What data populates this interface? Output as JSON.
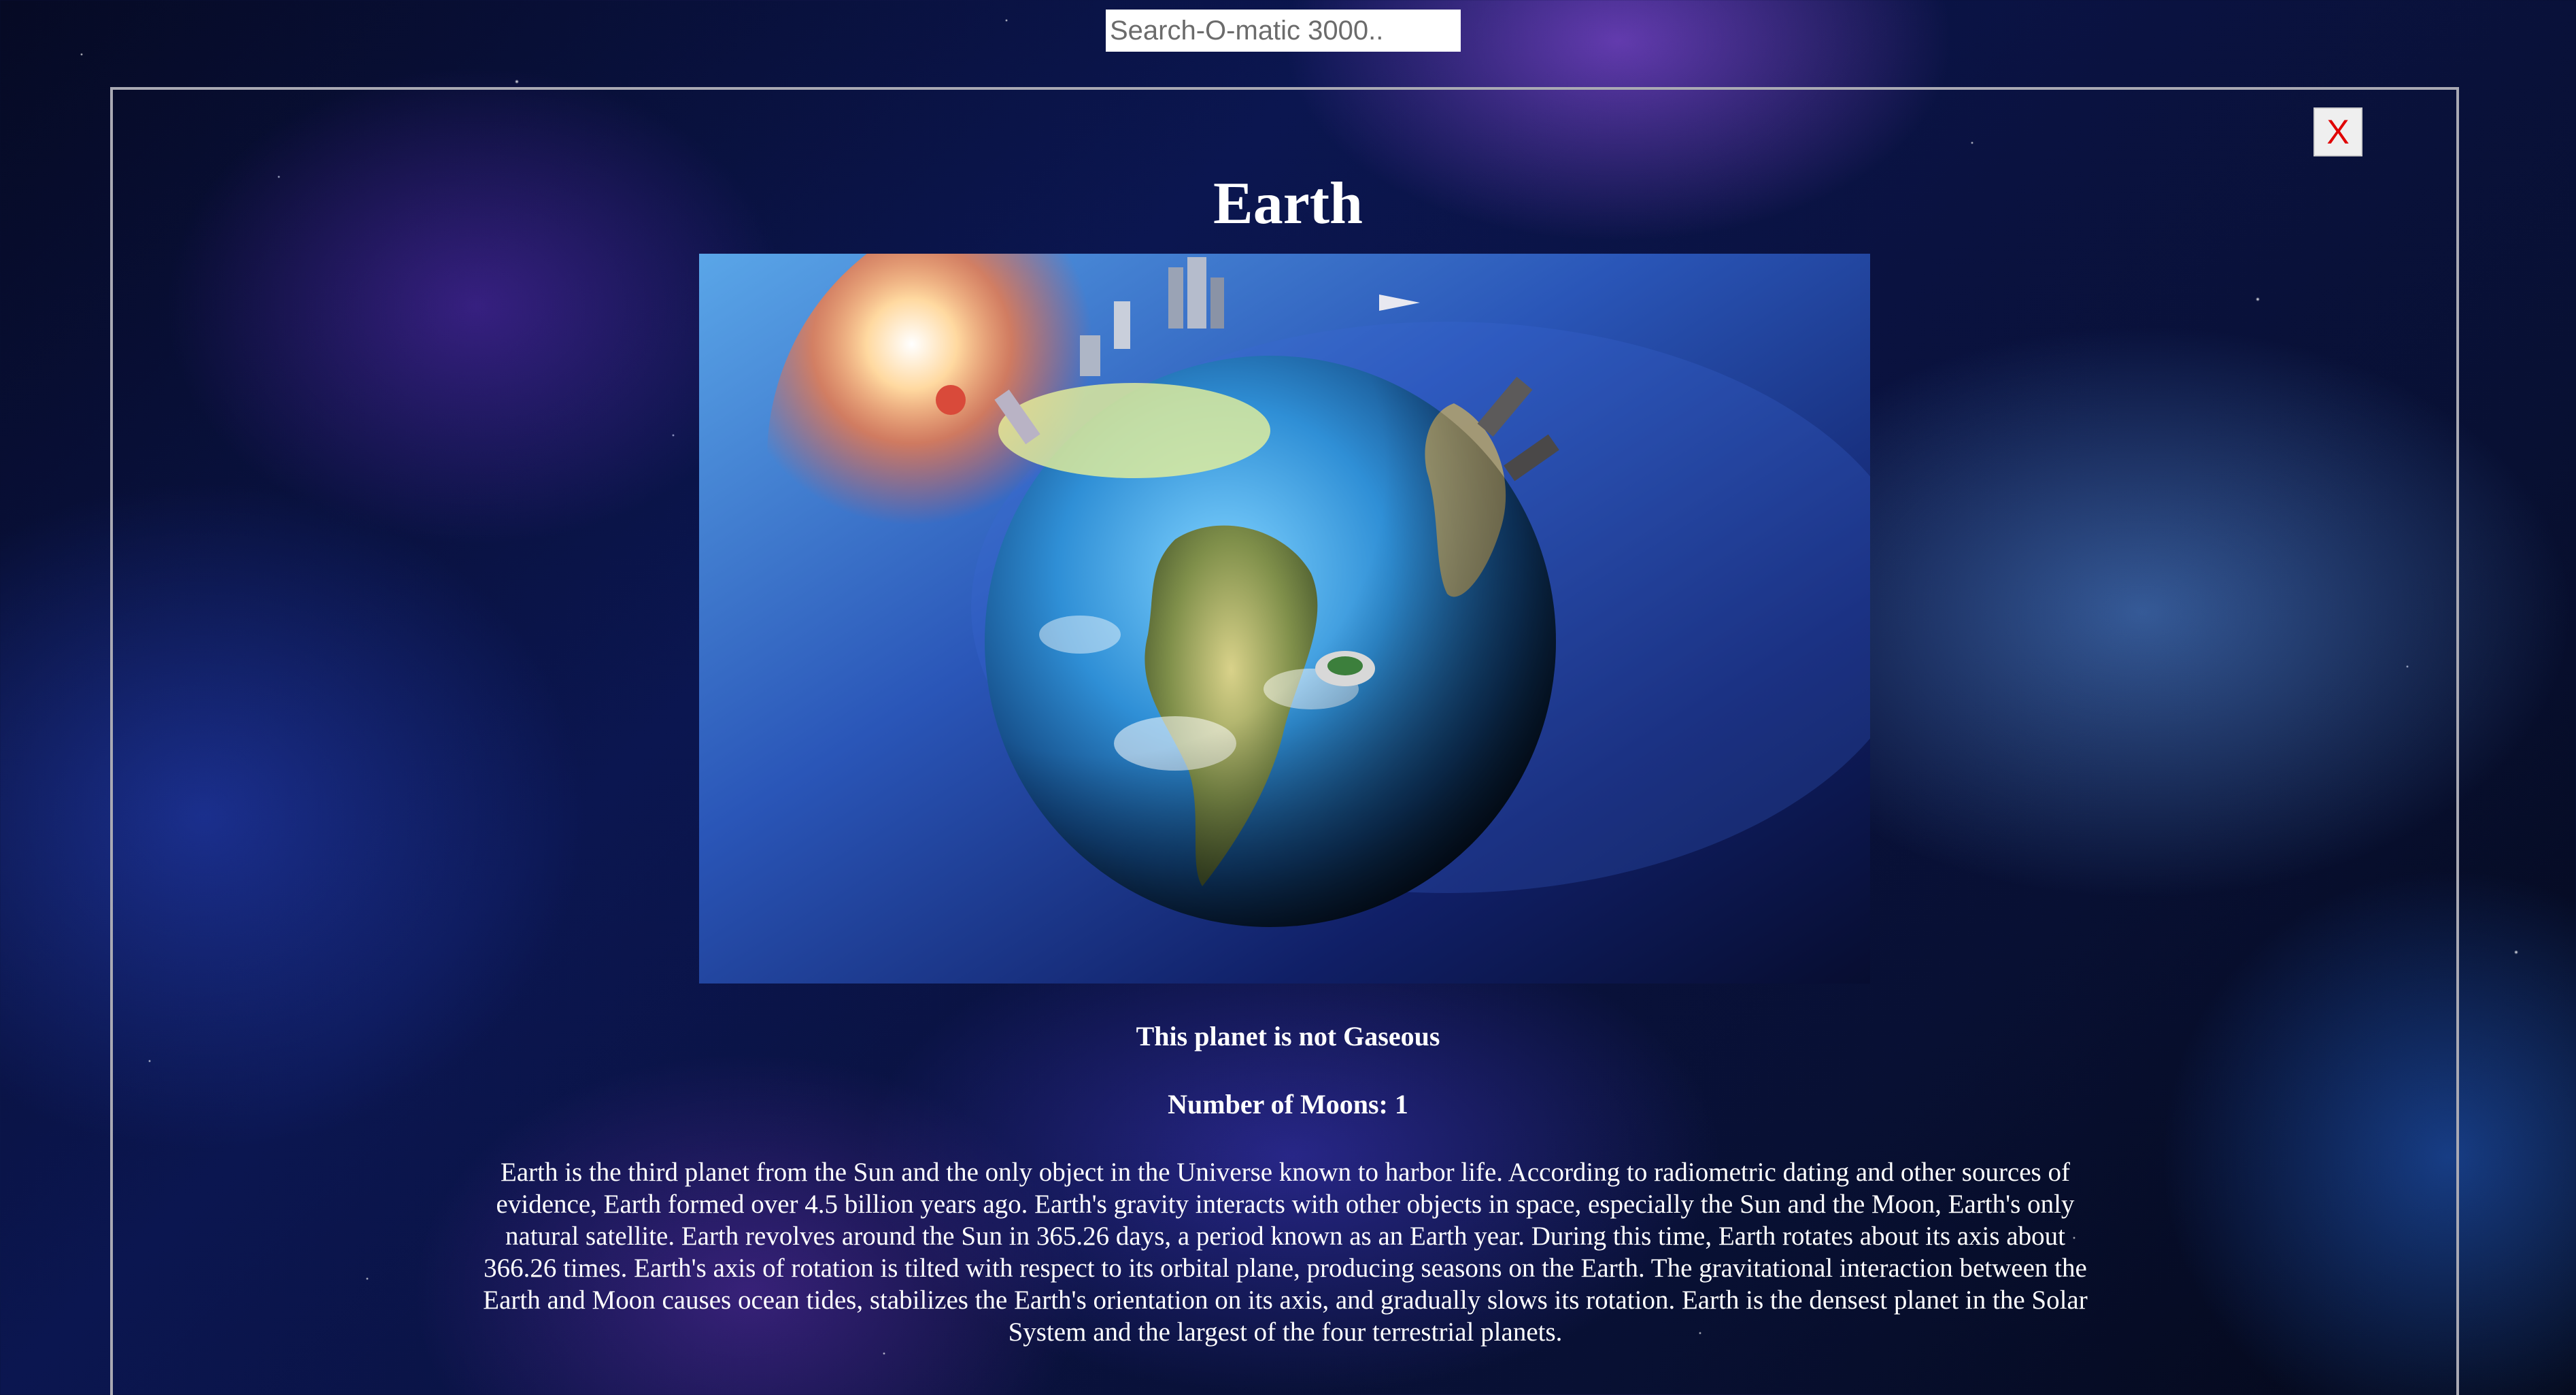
{
  "search": {
    "placeholder": "Search-O-matic 3000..",
    "value": ""
  },
  "modal": {
    "close_label": "X",
    "close_color": "#e00000"
  },
  "planet": {
    "name": "Earth",
    "image_subject": "earth-globe-with-cities-illustration",
    "gaseous_text": "This planet is not Gaseous",
    "moons_text": "Number of Moons: 1",
    "description": "Earth is the third planet from the Sun and the only object in the Universe known to harbor life. According to radiometric dating and other sources of evidence, Earth formed over 4.5 billion years ago. Earth's gravity interacts with other objects in space, especially the Sun and the Moon, Earth's only natural satellite. Earth revolves around the Sun in 365.26 days, a period known as an Earth year. During this time, Earth rotates about its axis about 366.26 times. Earth's axis of rotation is tilted with respect to its orbital plane, producing seasons on the Earth. The gravitational interaction between the Earth and Moon causes ocean tides, stabilizes the Earth's orientation on its axis, and gradually slows its rotation. Earth is the densest planet in the Solar System and the largest of the four terrestrial planets."
  },
  "colors": {
    "background": "#0b1650",
    "panel_border": "#a9a9b3",
    "text": "#ffffff"
  }
}
